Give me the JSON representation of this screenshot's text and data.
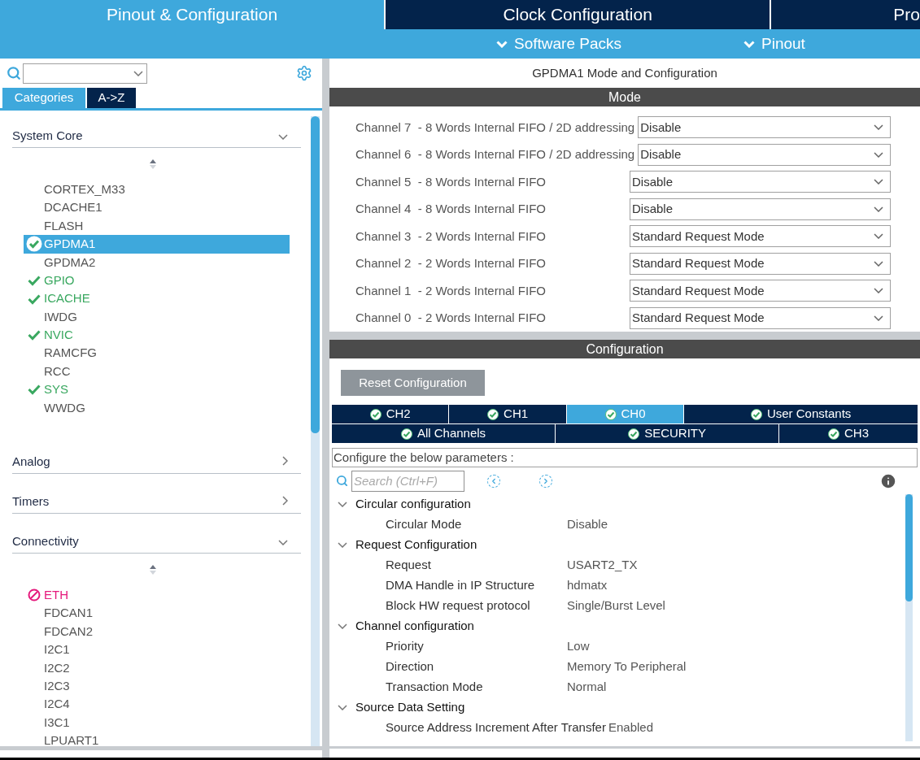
{
  "top_tabs": [
    {
      "label": "Pinout & Configuration",
      "selected": true
    },
    {
      "label": "Clock Configuration",
      "selected": false
    },
    {
      "label": "Pro",
      "selected": false
    }
  ],
  "sub_menu": [
    "Software Packs",
    "Pinout"
  ],
  "sidebar": {
    "view_tabs": [
      {
        "label": "Categories",
        "selected": true
      },
      {
        "label": "A->Z",
        "selected": false
      }
    ],
    "categories": [
      {
        "label": "System Core",
        "expanded": true,
        "items": [
          {
            "label": "CORTEX_M33",
            "kind": "plain",
            "selected": false
          },
          {
            "label": "DCACHE1",
            "kind": "plain",
            "selected": false
          },
          {
            "label": "FLASH",
            "kind": "plain",
            "selected": false
          },
          {
            "label": "GPDMA1",
            "kind": "configured",
            "selected": true
          },
          {
            "label": "GPDMA2",
            "kind": "plain",
            "selected": false
          },
          {
            "label": "GPIO",
            "kind": "configured",
            "selected": false
          },
          {
            "label": "ICACHE",
            "kind": "configured",
            "selected": false
          },
          {
            "label": "IWDG",
            "kind": "plain",
            "selected": false
          },
          {
            "label": "NVIC",
            "kind": "configured",
            "selected": false
          },
          {
            "label": "RAMCFG",
            "kind": "plain",
            "selected": false
          },
          {
            "label": "RCC",
            "kind": "plain",
            "selected": false
          },
          {
            "label": "SYS",
            "kind": "configured",
            "selected": false
          },
          {
            "label": "WWDG",
            "kind": "plain",
            "selected": false
          }
        ]
      },
      {
        "label": "Analog",
        "expanded": false
      },
      {
        "label": "Timers",
        "expanded": false
      },
      {
        "label": "Connectivity",
        "expanded": true,
        "items": [
          {
            "label": "ETH",
            "kind": "conflict",
            "selected": false
          },
          {
            "label": "FDCAN1",
            "kind": "plain",
            "selected": false
          },
          {
            "label": "FDCAN2",
            "kind": "plain",
            "selected": false
          },
          {
            "label": "I2C1",
            "kind": "plain",
            "selected": false
          },
          {
            "label": "I2C2",
            "kind": "plain",
            "selected": false
          },
          {
            "label": "I2C3",
            "kind": "plain",
            "selected": false
          },
          {
            "label": "I2C4",
            "kind": "plain",
            "selected": false
          },
          {
            "label": "I3C1",
            "kind": "plain",
            "selected": false
          },
          {
            "label": "LPUART1",
            "kind": "plain",
            "selected": false
          }
        ]
      }
    ]
  },
  "panel_title": "GPDMA1 Mode and Configuration",
  "mode": {
    "title": "Mode",
    "rows": [
      {
        "label": "Channel 7  - 8 Words Internal FIFO / 2D addressing",
        "value": "Disable"
      },
      {
        "label": "Channel 6  - 8 Words Internal FIFO / 2D addressing",
        "value": "Disable"
      },
      {
        "label": "Channel 5  - 8 Words Internal FIFO",
        "value": "Disable"
      },
      {
        "label": "Channel 4  - 8 Words Internal FIFO",
        "value": "Disable"
      },
      {
        "label": "Channel 3  - 2 Words Internal FIFO",
        "value": "Standard Request Mode"
      },
      {
        "label": "Channel 2  - 2 Words Internal FIFO",
        "value": "Standard Request Mode"
      },
      {
        "label": "Channel 1  - 2 Words Internal FIFO",
        "value": "Standard Request Mode"
      },
      {
        "label": "Channel 0  - 2 Words Internal FIFO",
        "value": "Standard Request Mode"
      }
    ]
  },
  "configuration": {
    "title": "Configuration",
    "reset_button": "Reset Configuration",
    "tab_rows": [
      [
        {
          "label": "CH2",
          "selected": false
        },
        {
          "label": "CH1",
          "selected": false
        },
        {
          "label": "CH0",
          "selected": true
        },
        {
          "label": "User Constants",
          "selected": false
        }
      ],
      [
        {
          "label": "All Channels",
          "selected": false
        },
        {
          "label": "SECURITY",
          "selected": false
        },
        {
          "label": "CH3",
          "selected": false
        }
      ]
    ],
    "hint": "Configure the below parameters :",
    "search": {
      "placeholder": "Search (Ctrl+F)"
    },
    "groups": [
      {
        "label": "Circular configuration",
        "expanded": true,
        "children": [
          {
            "label": "Circular Mode",
            "value": "Disable"
          }
        ]
      },
      {
        "label": "Request Configuration",
        "expanded": true,
        "children": [
          {
            "label": "Request",
            "value": "USART2_TX"
          },
          {
            "label": "DMA Handle in IP Structure",
            "value": "hdmatx"
          },
          {
            "label": "Block HW request protocol",
            "value": "Single/Burst Level"
          }
        ]
      },
      {
        "label": "Channel configuration",
        "expanded": true,
        "children": [
          {
            "label": "Priority",
            "value": "Low"
          },
          {
            "label": "Direction",
            "value": "Memory To Peripheral"
          },
          {
            "label": "Transaction Mode",
            "value": "Normal"
          }
        ]
      },
      {
        "label": "Source Data Setting",
        "expanded": true,
        "children": [
          {
            "label": "Source Address Increment After Transfer",
            "value": "Enabled"
          }
        ]
      }
    ]
  }
}
